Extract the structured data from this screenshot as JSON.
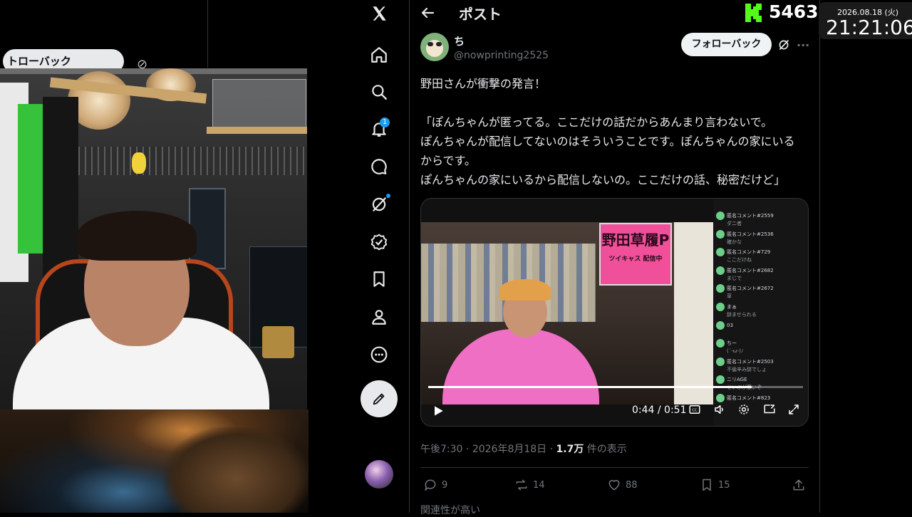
{
  "left_panel": {
    "ghost_button_label": "トローバック"
  },
  "nav": {
    "notification_count": "1"
  },
  "post": {
    "header_title": "ポスト",
    "author_name": "ち",
    "author_handle": "@nowprinting2525",
    "follow_label": "フォローバック",
    "body_lines": [
      "野田さんが衝撃の発言！",
      "「ぽんちゃんが匿ってる。ここだけの話だからあんまり言わないで。",
      "ぽんちゃんが配信してないのはそういうことです。ぽんちゃんの家にいる",
      "からです。",
      "ぽんちゃんの家にいるから配信しないの。ここだけの話、秘密だけど」"
    ],
    "video": {
      "time_label": "0:44 / 0:51",
      "progress": 0.8627,
      "banner_title": "野田草履P",
      "banner_subtitle": "ツイキャス 配信中",
      "comments": [
        {
          "name": "匿名コメント#2559",
          "text": "ダニ者"
        },
        {
          "name": "匿名コメント#2536",
          "text": "確かな"
        },
        {
          "name": "匿名コメント#729",
          "text": "ここだけね"
        },
        {
          "name": "匿名コメント#2682",
          "text": "まじで"
        },
        {
          "name": "匿名コメント#2672",
          "text": "草"
        },
        {
          "name": "まぁ",
          "text": "辞ませられる"
        },
        {
          "name": "03",
          "text": ""
        },
        {
          "name": "ちー",
          "text": "(´-ω-)ﾉ"
        },
        {
          "name": "匿名コメント#2503",
          "text": "不倫辛み辞でしょ"
        },
        {
          "name": "ニリAGE",
          "text": "せいぶが悪いぞ"
        },
        {
          "name": "匿名コメント#823",
          "text": ""
        }
      ]
    },
    "meta": {
      "time": "午後7:30",
      "date": "2026年8月18日",
      "views": "1.7万",
      "views_suffix": "件の表示"
    },
    "actions": {
      "replies": "9",
      "reposts": "14",
      "likes": "88",
      "bookmarks": "15"
    },
    "related_label": "関連性が高い"
  },
  "overlay": {
    "viewer_count": "5463",
    "date": "2026.08.18 (火)",
    "time": "21:21:06"
  },
  "colors": {
    "accent": "#1d9bf0",
    "kick_green": "#53fc18",
    "banner_pink": "#f0509a"
  }
}
